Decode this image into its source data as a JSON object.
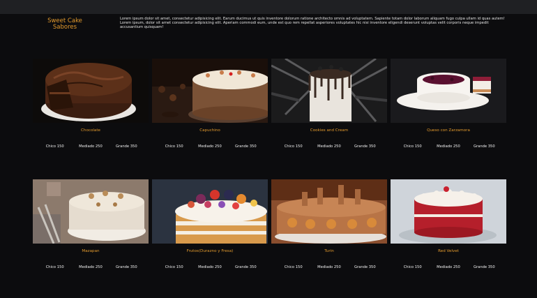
{
  "header": {
    "brand_line1": "Sweet Cake",
    "brand_line2": "Sabores",
    "intro": "Lorem ipsum dolor sit amet, consectetur adipisicing elit. Earum ducimus ut quis inventore dolorum ratione architecto omnis ad voluptatem. Sapiente totam dolor laborum aliquam fugo culpa ullam id quas autem! Lorem ipsum, dolor sit amet consectetur adipisicing elit. Aperiam commodi eum, unde est quo rem repellat asperiores voluptates hic nisi inventore eligendi deserunt voluptas velit corporis neque impedit accusantium quisquam!"
  },
  "colors": {
    "accent": "#e39a2d",
    "background": "#0c0c0e",
    "topbar": "#1f2023"
  },
  "products": [
    {
      "name": "Chocolate",
      "chico": "Chico 150",
      "mediano": "Mediado 250",
      "grande": "Grande 350",
      "icon": "chocolate-cake"
    },
    {
      "name": "Capuchino",
      "chico": "Chico 150",
      "mediano": "Mediado 250",
      "grande": "Grande 350",
      "icon": "capuccino-cake"
    },
    {
      "name": "Cookies and Cream",
      "chico": "Chico 150",
      "mediano": "Mediado 250",
      "grande": "Grande 350",
      "icon": "cookies-cream-cake"
    },
    {
      "name": "Queso con Zarzamora",
      "chico": "Chico 150",
      "mediano": "Mediado 250",
      "grande": "Grande 350",
      "icon": "cheesecake"
    },
    {
      "name": "Mazapan",
      "chico": "Chico 150",
      "mediano": "Mediado 250",
      "grande": "Grande 350",
      "icon": "mazapan-cake"
    },
    {
      "name": "Frutos(Durazno y Fresa)",
      "chico": "Chico 150",
      "mediano": "Mediado 250",
      "grande": "Grande 350",
      "icon": "fruit-cake"
    },
    {
      "name": "Turin",
      "chico": "Chico 150",
      "mediano": "Mediado 250",
      "grande": "Grande 350",
      "icon": "turin-cake"
    },
    {
      "name": "Red Velvet",
      "chico": "Chico 150",
      "mediano": "Mediado 250",
      "grande": "Grande 350",
      "icon": "red-velvet-cake"
    }
  ]
}
